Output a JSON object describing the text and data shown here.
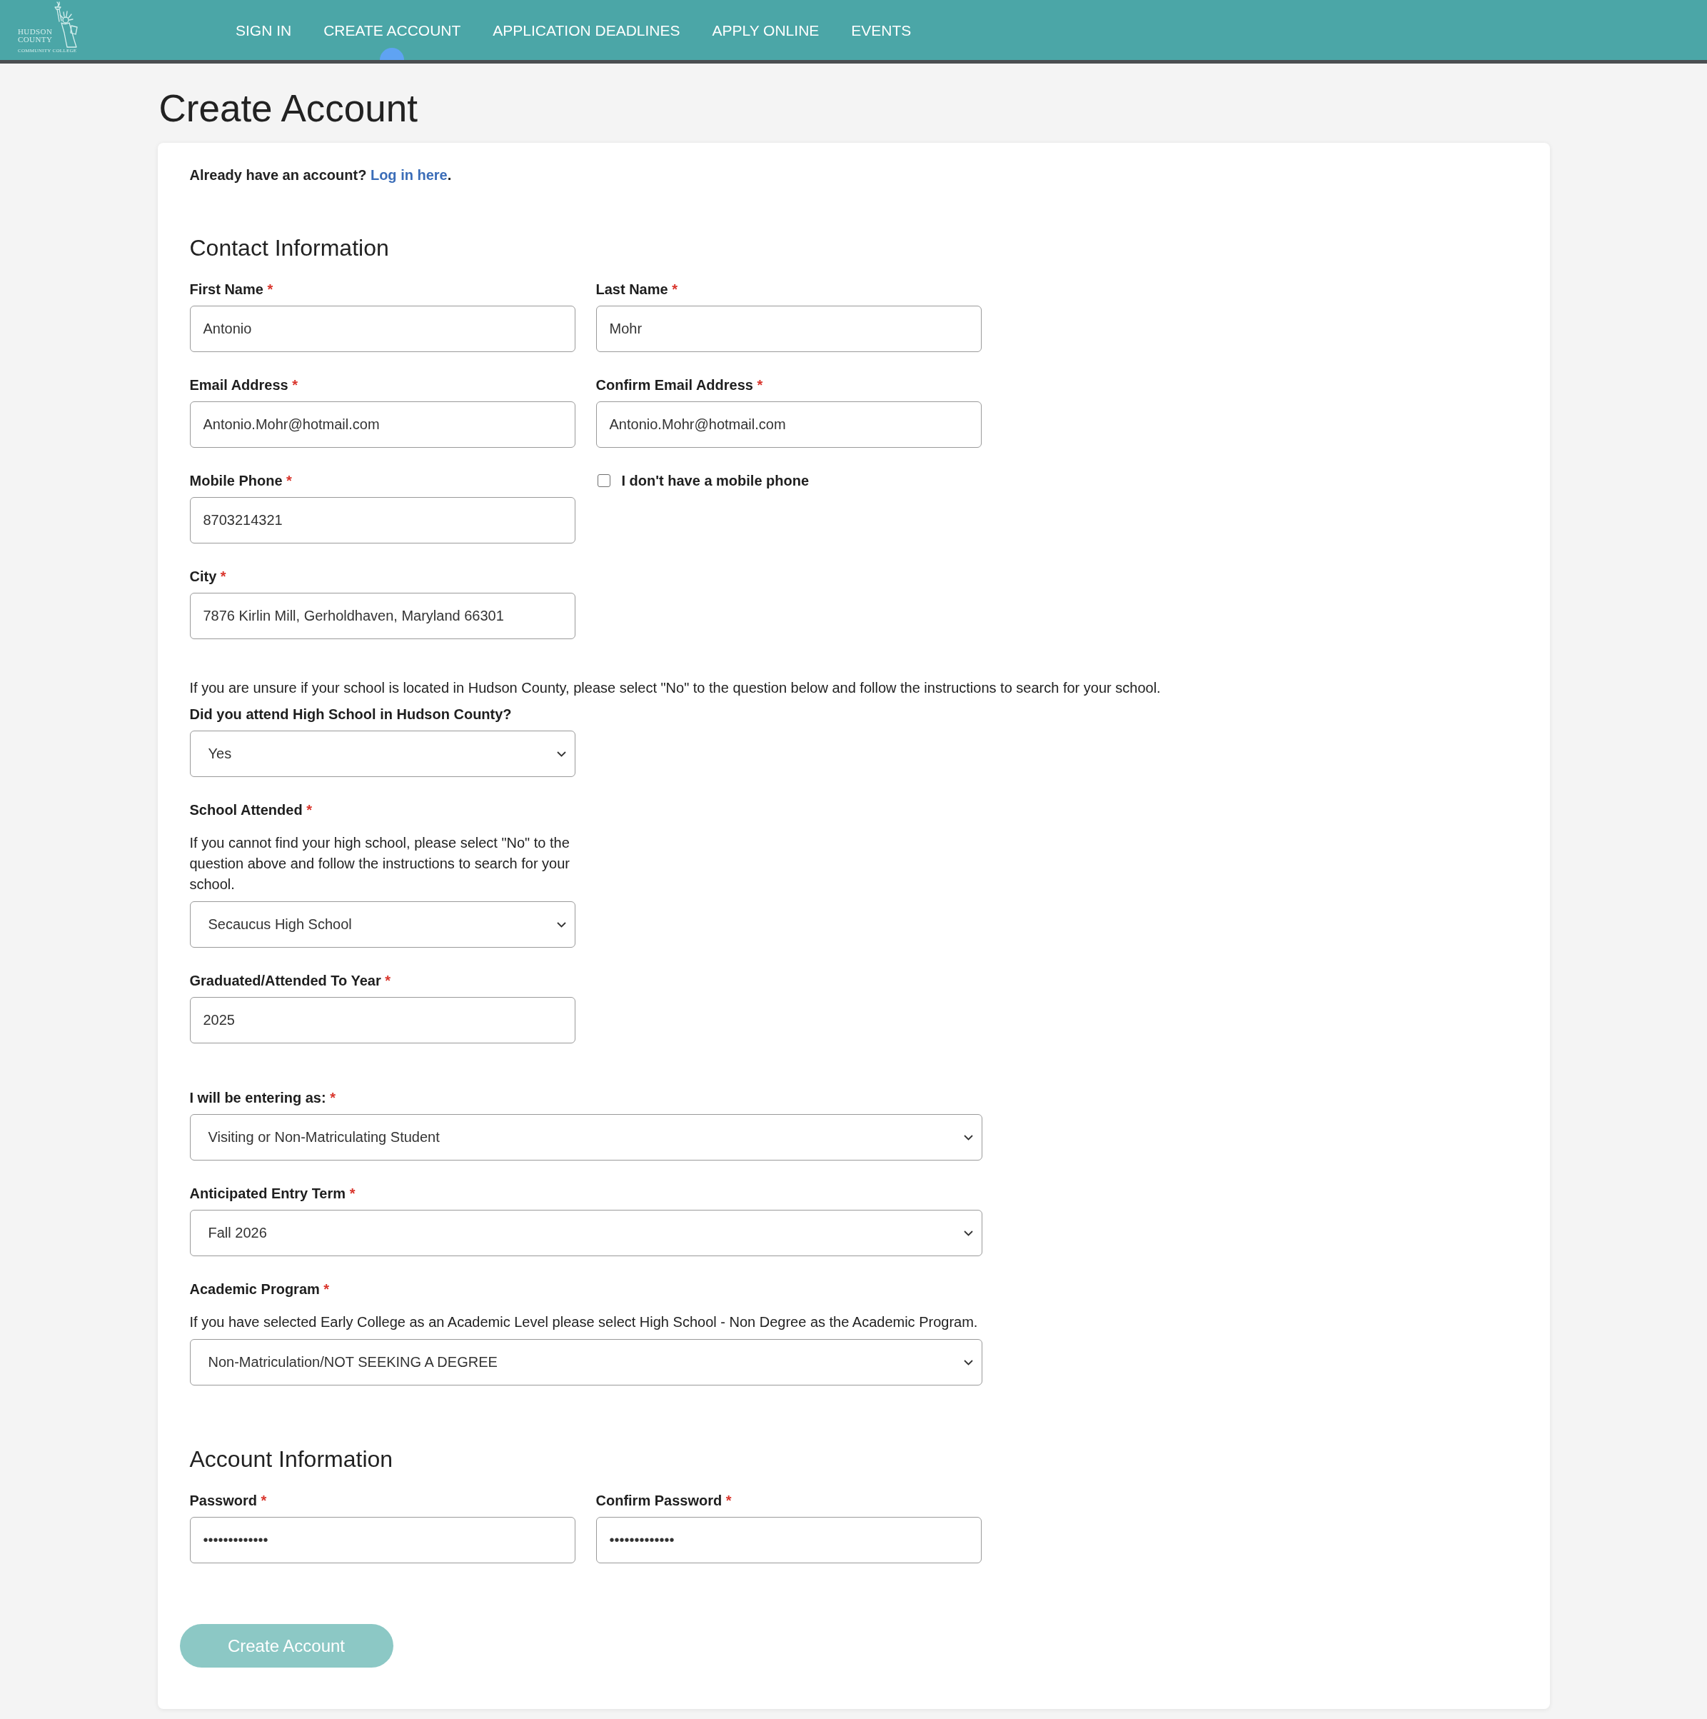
{
  "header": {
    "logo": {
      "lines": [
        "HUDSON",
        "COUNTY",
        "COMMUNITY COLLEGE"
      ]
    },
    "nav": [
      {
        "label": "SIGN IN",
        "selected": false
      },
      {
        "label": "CREATE ACCOUNT",
        "selected": true
      },
      {
        "label": "APPLICATION DEADLINES",
        "selected": false
      },
      {
        "label": "APPLY ONLINE",
        "selected": false
      },
      {
        "label": "EVENTS",
        "selected": false
      }
    ]
  },
  "page_title": "Create Account",
  "card": {
    "login_prompt": {
      "text": "Already have an account?",
      "link": "Log in here",
      "end": "."
    },
    "sections": [
      {
        "title": "Contact Information",
        "groups": [
          {
            "kind": "pairs",
            "fields": [
              {
                "kind": "text",
                "label": "First Name",
                "required_mark": "*",
                "value": "Antonio"
              },
              {
                "kind": "text",
                "label": "Last Name",
                "required_mark": "*",
                "value": "Mohr"
              },
              {
                "kind": "text",
                "label": "Email Address",
                "required_mark": "*",
                "value": "Antonio.Mohr@hotmail.com"
              },
              {
                "kind": "text",
                "label": "Confirm Email Address",
                "required_mark": "*",
                "value": "Antonio.Mohr@hotmail.com"
              },
              {
                "kind": "text",
                "label": "Mobile Phone",
                "required_mark": "*",
                "value": "8703214321"
              },
              {
                "kind": "checkbox",
                "label": "I don't have a mobile phone",
                "checked": false
              },
              {
                "kind": "text",
                "label": "City",
                "required_mark": "*",
                "value": "7876 Kirlin Mill, Gerholdhaven, Maryland 66301"
              }
            ]
          },
          {
            "kind": "note",
            "text": "If you are unsure if your school is located in Hudson County, please select \"No\" to the question below and follow the instructions to search for your school."
          },
          {
            "kind": "narrow",
            "fields": [
              {
                "kind": "select",
                "label": "Did you attend High School in Hudson County?",
                "value": "Yes"
              },
              {
                "kind": "select",
                "label": "School Attended",
                "required_mark": "*",
                "help": "If you cannot find your high school, please select \"No\" to the question above and follow the instructions to search for your school.",
                "value": "Secaucus High School"
              },
              {
                "kind": "text",
                "label": "Graduated/Attended To Year",
                "required_mark": "*",
                "value": "2025"
              }
            ]
          },
          {
            "kind": "wide",
            "fields": [
              {
                "kind": "select",
                "label": "I will be entering as:",
                "required_mark": "*",
                "value": "Visiting or Non-Matriculating Student"
              },
              {
                "kind": "select",
                "label": "Anticipated Entry Term",
                "required_mark": "*",
                "value": "Fall 2026"
              },
              {
                "kind": "select",
                "label": "Academic Program",
                "required_mark": "*",
                "help": "If you have selected Early College as an Academic Level please select High School - Non Degree as the Academic Program.",
                "value": "Non-Matriculation/NOT SEEKING A DEGREE"
              }
            ]
          }
        ]
      },
      {
        "title": "Account Information",
        "groups": [
          {
            "kind": "pairs",
            "fields": [
              {
                "kind": "password",
                "label": "Password",
                "required_mark": "*",
                "value": "•••••••••••••"
              },
              {
                "kind": "password",
                "label": "Confirm Password",
                "required_mark": "*",
                "value": "•••••••••••••"
              }
            ]
          }
        ]
      }
    ],
    "submit_button": {
      "label": "Create Account",
      "disabled": true
    }
  }
}
